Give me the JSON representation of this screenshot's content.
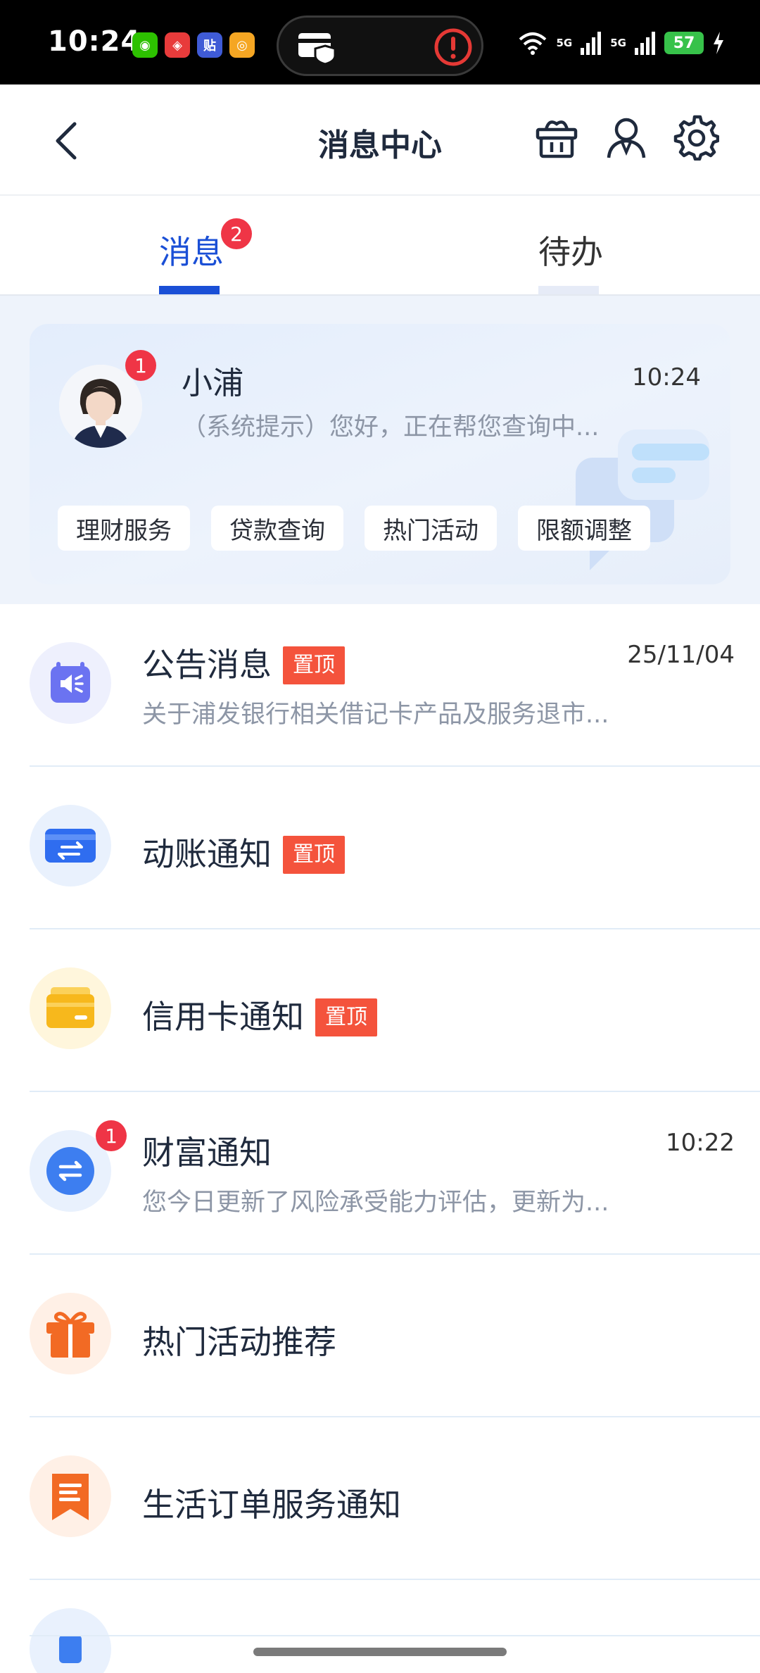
{
  "status_bar": {
    "time": "10:24",
    "signal_1": "5G",
    "signal_2": "5G",
    "battery": "57",
    "apps": [
      {
        "name": "wechat-icon",
        "color": "#2dc100",
        "glyph": "◉"
      },
      {
        "name": "app2-icon",
        "color": "#e83b3b",
        "glyph": "◈"
      },
      {
        "name": "tieba-icon",
        "color": "#3f5bd6",
        "glyph": "贴"
      },
      {
        "name": "weibo-icon",
        "color": "#f5a623",
        "glyph": "◎"
      }
    ]
  },
  "nav": {
    "title": "消息中心"
  },
  "tabs": [
    {
      "label": "消息",
      "badge": "2",
      "active": true
    },
    {
      "label": "待办",
      "active": false
    }
  ],
  "assistant": {
    "name": "小浦",
    "badge": "1",
    "time": "10:24",
    "preview": "（系统提示）您好，正在帮您查询中...",
    "quick_actions": [
      "理财服务",
      "贷款查询",
      "热门活动",
      "限额调整"
    ]
  },
  "messages": [
    {
      "title": "公告消息",
      "tag": "置顶",
      "time": "25/11/04",
      "preview": "关于浦发银行相关借记卡产品及服务退市...",
      "icon": "announcement-icon"
    },
    {
      "title": "动账通知",
      "tag": "置顶",
      "icon": "account-transfer-icon"
    },
    {
      "title": "信用卡通知",
      "tag": "置顶",
      "icon": "credit-card-icon"
    },
    {
      "title": "财富通知",
      "badge": "1",
      "time": "10:22",
      "preview": "您今日更新了风险承受能力评估，更新为...",
      "icon": "exchange-icon"
    },
    {
      "title": "热门活动推荐",
      "icon": "gift-icon"
    },
    {
      "title": "生活订单服务通知",
      "icon": "bookmark-icon"
    }
  ]
}
